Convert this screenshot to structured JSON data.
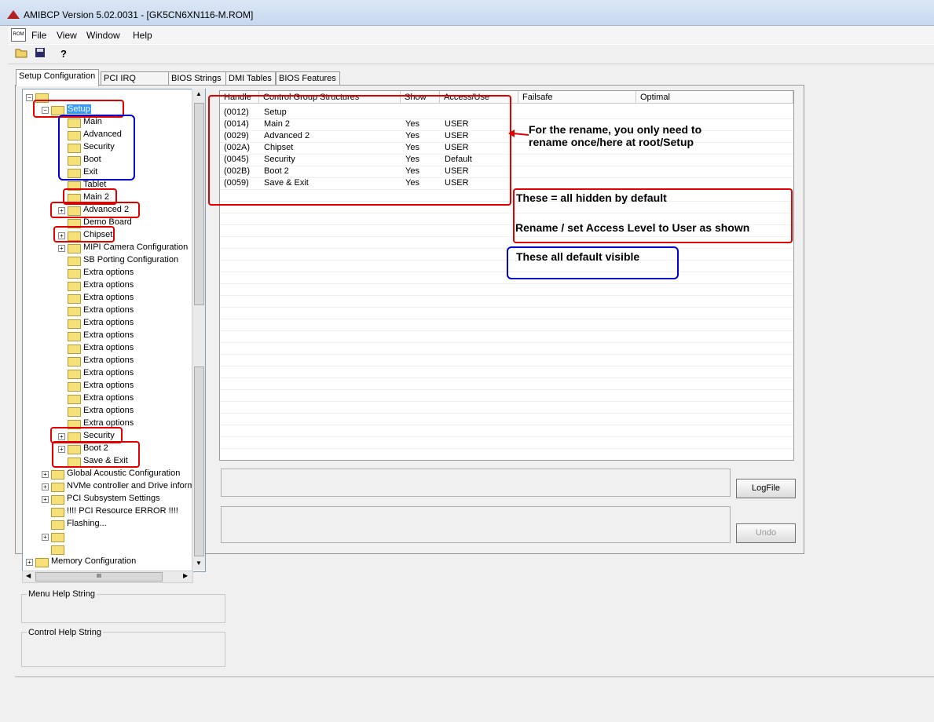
{
  "window": {
    "title": "AMIBCP Version 5.02.0031 - [GK5CN6XN116-M.ROM]",
    "doc_icon_text": "ROM"
  },
  "menu": [
    "File",
    "View",
    "Window",
    "Help"
  ],
  "toolbar": {
    "help_glyph": "?"
  },
  "tabs": [
    "Setup Configuration",
    "PCI IRQ Routing",
    "BIOS Strings",
    "DMI Tables",
    "BIOS Features"
  ],
  "tree": {
    "setup": "Setup",
    "items": [
      "Main",
      "Advanced",
      "Security",
      "Boot",
      "Exit",
      "Tablet",
      "Main 2",
      "Advanced 2",
      "Demo Board",
      "Chipset",
      "MIPI Camera Configuration",
      "SB Porting Configuration",
      "Extra options",
      "Extra options",
      "Extra options",
      "Extra options",
      "Extra options",
      "Extra options",
      "Extra options",
      "Extra options",
      "Extra options",
      "Extra options",
      "Extra options",
      "Extra options",
      "Extra options",
      "Security",
      "Boot 2",
      "Save & Exit"
    ],
    "top_items": [
      "Global Acoustic Configuration",
      "NVMe controller and Drive inform",
      "PCI Subsystem Settings",
      "!!!! PCI Resource ERROR !!!!",
      "Flashing...",
      "",
      ""
    ],
    "memory": "Memory Configuration",
    "hscroll_grip": "III"
  },
  "table": {
    "columns": [
      "Handle",
      "Control Group Structures",
      "Show",
      "Access/Use",
      "Failsafe",
      "Optimal"
    ],
    "rows": [
      [
        "(0012)",
        "Setup",
        "",
        ""
      ],
      [
        "(0014)",
        "Main 2",
        "Yes",
        "USER"
      ],
      [
        "(0029)",
        "Advanced 2",
        "Yes",
        "USER"
      ],
      [
        "(002A)",
        "Chipset",
        "Yes",
        "USER"
      ],
      [
        "(0045)",
        "Security",
        "Yes",
        "Default"
      ],
      [
        "(002B)",
        "Boot 2",
        "Yes",
        "USER"
      ],
      [
        "(0059)",
        "Save & Exit",
        "Yes",
        "USER"
      ]
    ]
  },
  "annotations": {
    "rename_note": "For the rename, you only need to rename once/here at root/Setup",
    "hidden_line1": "These = all hidden by default",
    "hidden_line2": "Rename / set Access Level to User as shown",
    "visible_note": "These all default visible"
  },
  "buttons": {
    "logfile": "LogFile",
    "undo": "Undo"
  },
  "groups": {
    "menu_help": "Menu Help String",
    "control_help": "Control Help String"
  },
  "colors": {
    "annotation_red": "#e00000",
    "annotation_blue": "#0000d0"
  }
}
